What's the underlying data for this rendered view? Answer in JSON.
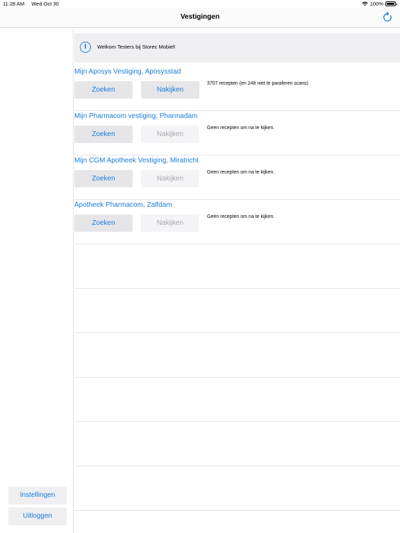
{
  "status_bar": {
    "time": "11:28 AM",
    "date": "Wed Oct 30",
    "battery": "100%"
  },
  "nav": {
    "title": "Vestigingen"
  },
  "banner": {
    "text": "Welkom Testers bij Storec Mobiel!"
  },
  "branches": [
    {
      "name": "Mijn Aposys Vestiging, Aposysstad",
      "search_label": "Zoeken",
      "check_label": "Nakijken",
      "check_enabled": true,
      "status": "3707 recepten (en 248 niet te paraferen scans)"
    },
    {
      "name": "Mijn Pharmacom vestiging, Pharmadam",
      "search_label": "Zoeken",
      "check_label": "Nakijken",
      "check_enabled": false,
      "status": "Geen recepten om na te kijken."
    },
    {
      "name": "Mijn CGM Apotheek Vestiging, Miratricht",
      "search_label": "Zoeken",
      "check_label": "Nakijken",
      "check_enabled": false,
      "status": "Geen recepten om na te kijken."
    },
    {
      "name": "Apotheek Pharmacom, Zalfdam",
      "search_label": "Zoeken",
      "check_label": "Nakijken",
      "check_enabled": false,
      "status": "Geen recepten om na te kijken."
    }
  ],
  "sidebar": {
    "settings_label": "Instellingen",
    "logout_label": "Uitloggen"
  },
  "colors": {
    "accent": "#1a7bd9",
    "button_bg": "#e6e6e9",
    "disabled_text": "#a8a8ac"
  },
  "icons": {
    "refresh": "refresh-icon",
    "info": "info-icon",
    "wifi": "wifi-icon",
    "battery": "battery-icon"
  }
}
